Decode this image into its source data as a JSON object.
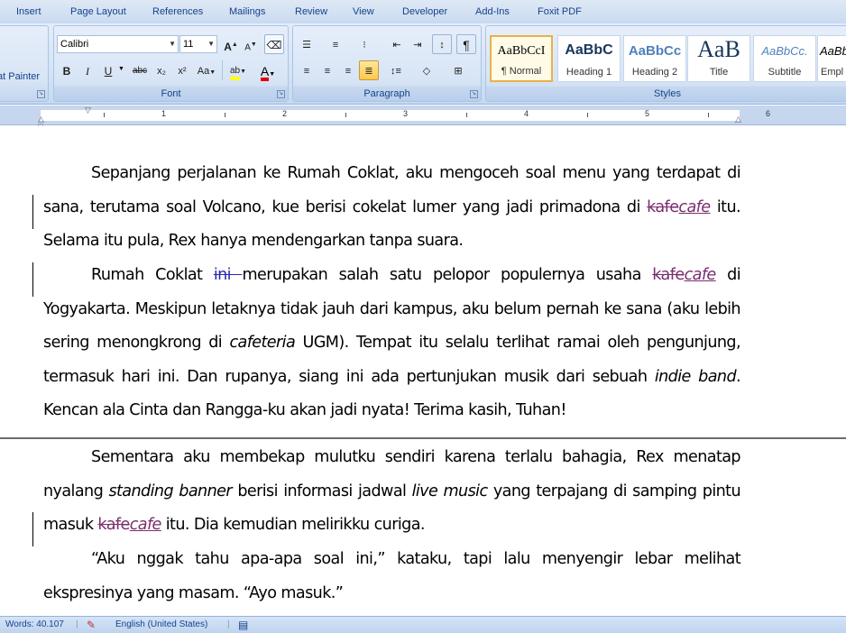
{
  "tabs": [
    "Insert",
    "Page Layout",
    "References",
    "Mailings",
    "Review",
    "View",
    "Developer",
    "Add-Ins",
    "Foxit PDF"
  ],
  "clipboard": {
    "format_painter": "at Painter"
  },
  "font": {
    "name": "Calibri",
    "size": "11",
    "group_label": "Font",
    "buttons": {
      "bold": "B",
      "italic": "I",
      "underline": "U",
      "strike": "abc",
      "subscript": "x₂",
      "superscript": "x²",
      "change_case": "Aa",
      "highlight": "ab",
      "font_color": "A",
      "grow": "A",
      "shrink": "A"
    }
  },
  "paragraph": {
    "group_label": "Paragraph",
    "pilcrow": "¶"
  },
  "styles": {
    "group_label": "Styles",
    "items": [
      {
        "sample": "AaBbCcI",
        "name": "¶ Normal"
      },
      {
        "sample": "AaBbC",
        "name": "Heading 1"
      },
      {
        "sample": "AaBbCc",
        "name": "Heading 2"
      },
      {
        "sample": "AaB",
        "name": "Title"
      },
      {
        "sample": "AaBbCc.",
        "name": "Subtitle"
      },
      {
        "sample": "AaBb",
        "name": "Empl"
      }
    ]
  },
  "ruler": {
    "numbers": [
      "1",
      "2",
      "3",
      "4",
      "5",
      "6"
    ]
  },
  "document": {
    "p1": {
      "a": "Sepanjang perjalanan ke Rumah Coklat, aku mengoceh soal menu yang terdapat di sana, terutama soal Volcano, kue berisi cokelat lumer yang jadi primadona di ",
      "del": "kafe",
      "ins": "cafe",
      "b": " itu. Selama itu pula, Rex hanya mendengarkan tanpa suara."
    },
    "p2": {
      "a": "Rumah Coklat ",
      "del1": "ini ",
      "b": "merupakan salah satu pelopor populernya usaha ",
      "del2": "kafe",
      "ins2": "cafe",
      "c": " di Yogyakarta. Meskipun letaknya tidak jauh dari kampus, aku belum pernah ke sana (aku lebih sering menongkrong di ",
      "it1": "cafeteria",
      "d": " UGM). Tempat itu selalu terlihat ramai oleh pengunjung, termasuk hari ini. Dan rupanya, siang ini ada pertunjukan musik dari sebuah ",
      "it2": "indie band",
      "e": ". Kencan ala Cinta dan Rangga-ku akan jadi nyata! Terima kasih, Tuhan!"
    },
    "p3": {
      "a": "Sementara aku membekap mulutku sendiri karena terlalu bahagia, Rex menatap nyalang ",
      "it1": "standing banner",
      "b": " berisi informasi jadwal ",
      "it2": "live music",
      "c": " yang terpajang di samping pintu masuk ",
      "del": "kafe",
      "ins": "cafe",
      "d": " itu. Dia kemudian melirikku curiga."
    },
    "p4": {
      "text": "“Aku nggak tahu apa-apa soal ini,” kataku, tapi lalu menyengir lebar melihat ekspresinya yang masam. “Ayo masuk.”"
    }
  },
  "status": {
    "words": "Words: 40.107",
    "language": "English (United States)"
  }
}
